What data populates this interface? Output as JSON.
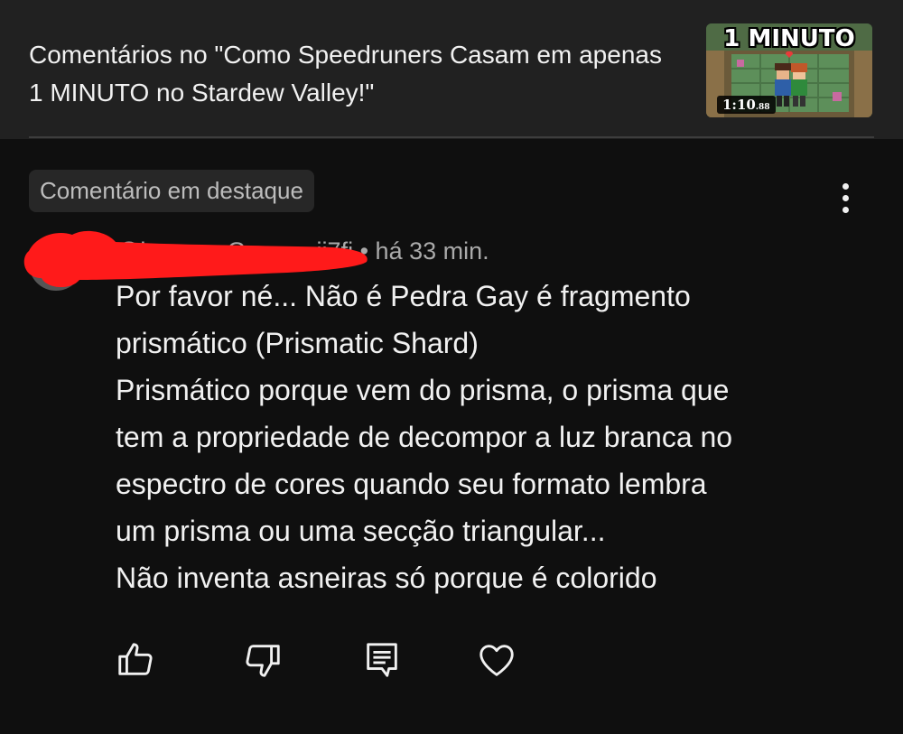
{
  "header": {
    "title": "Comentários no \"Como Speedruners Casam em apenas 1 MINUTO no Stardew Valley!\"",
    "thumbnail": {
      "caption": "1 MINUTO",
      "duration_main": "1:10",
      "duration_fraction": ".88"
    }
  },
  "comment": {
    "badge": "Comentário em destaque",
    "author": "@lp_____Grr____ji7fi",
    "time": "• há 33 min.",
    "lines": [
      "Por favor né... Não é Pedra Gay é fragmento",
      "prismático (Prismatic Shard)",
      "Prismático porque vem do prisma, o prisma que",
      "tem a propriedade de decompor a luz branca no",
      "espectro de cores quando seu formato lembra",
      "um prisma ou uma secção triangular...",
      "Não inventa asneiras só porque é colorido"
    ]
  },
  "actions": {
    "icons": [
      "thumbs-up-icon",
      "thumbs-down-icon",
      "reply-icon",
      "heart-icon"
    ]
  },
  "colors": {
    "background": "#0f0f0f",
    "header_background": "#212121",
    "badge_background": "#272727",
    "text_primary": "#f1f1f1",
    "text_secondary": "#aaaaaa",
    "redaction": "#ff1a1a"
  }
}
